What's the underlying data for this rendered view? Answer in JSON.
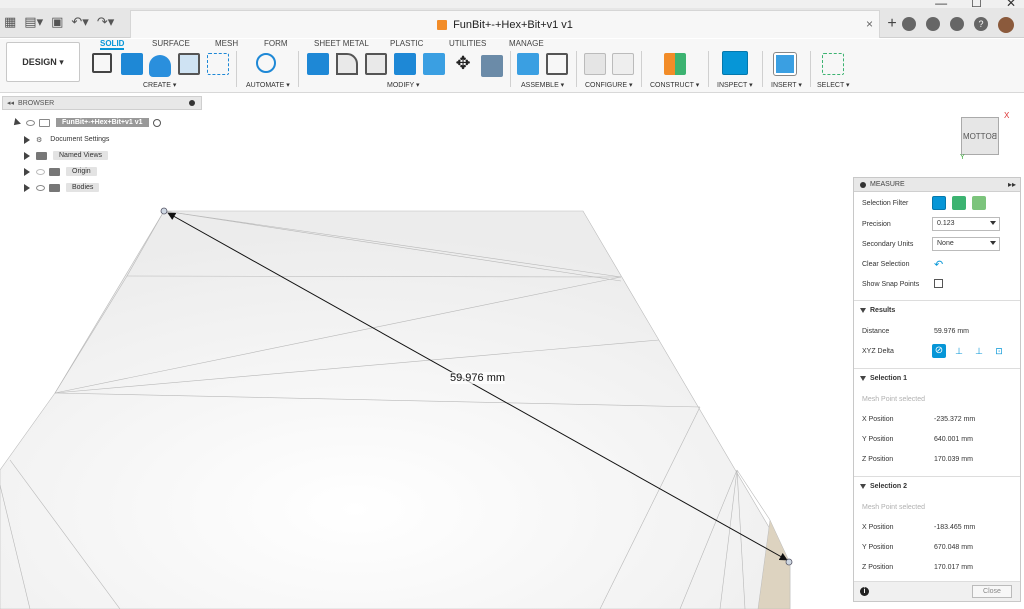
{
  "window": {
    "minimize": "—",
    "maximize": "☐",
    "close": "✕"
  },
  "title": {
    "doc_name": "FunBit+-+Hex+Bit+v1 v1",
    "tab_close": "×",
    "new_tab": "+"
  },
  "ribbon": {
    "workspace": "DESIGN ▾",
    "tabs": [
      "SOLID",
      "SURFACE",
      "MESH",
      "FORM",
      "SHEET METAL",
      "PLASTIC",
      "UTILITIES",
      "MANAGE"
    ],
    "groups": [
      "CREATE ▾",
      "AUTOMATE ▾",
      "MODIFY ▾",
      "ASSEMBLE ▾",
      "CONFIGURE ▾",
      "CONSTRUCT ▾",
      "INSPECT ▾",
      "INSERT ▾",
      "SELECT ▾"
    ]
  },
  "browser": {
    "title": "BROWSER",
    "collapse": "◂◂",
    "root": "FunBit+-+Hex+Bit+v1 v1",
    "items": [
      "Document Settings",
      "Named Views",
      "Origin",
      "Bodies"
    ]
  },
  "viewcube": {
    "face": "BOTTOM",
    "x": "X",
    "y": "Y"
  },
  "viewport": {
    "dimension": "59.976 mm"
  },
  "measure": {
    "title": "MEASURE",
    "expand": "▸▸",
    "selection_filter_label": "Selection Filter",
    "precision_label": "Precision",
    "precision_value": "0.123",
    "secondary_units_label": "Secondary Units",
    "secondary_units_value": "None",
    "clear_selection_label": "Clear Selection",
    "show_snap_label": "Show Snap Points",
    "results_title": "Results",
    "distance_label": "Distance",
    "distance_value": "59.976 mm",
    "xyz_delta_label": "XYZ Delta",
    "selection1": {
      "title": "Selection 1",
      "type": "Mesh Point selected",
      "x_label": "X Position",
      "x_value": "-235.372 mm",
      "y_label": "Y Position",
      "y_value": "640.001 mm",
      "z_label": "Z Position",
      "z_value": "170.039 mm"
    },
    "selection2": {
      "title": "Selection 2",
      "type": "Mesh Point selected",
      "x_label": "X Position",
      "x_value": "-183.465 mm",
      "y_label": "Y Position",
      "y_value": "670.048 mm",
      "z_label": "Z Position",
      "z_value": "170.017 mm"
    },
    "close_label": "Close",
    "info": "i"
  },
  "colors": {
    "accent": "#0696d7",
    "orange": "#f28c28",
    "green": "#3cb371"
  }
}
